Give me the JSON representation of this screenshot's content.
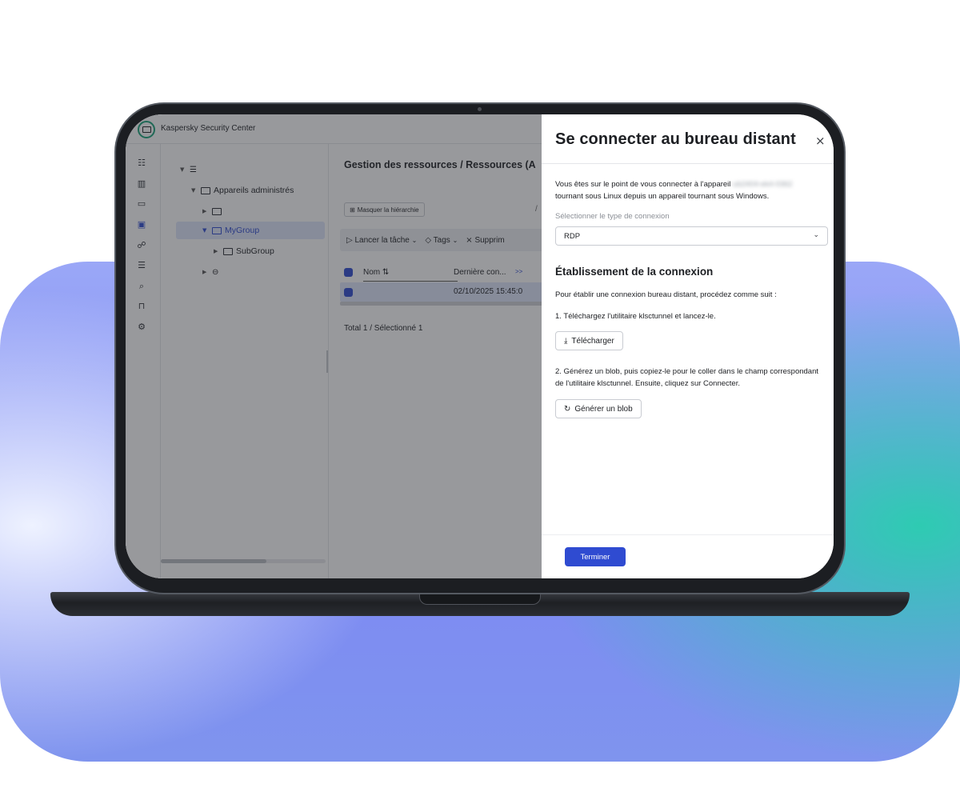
{
  "app": {
    "title": "Kaspersky Security Center",
    "rail_icons": [
      "dashboard-icon",
      "map-icon",
      "monitor-icon",
      "devices-icon",
      "users-icon",
      "servers-icon",
      "search-icon",
      "store-icon",
      "settings-icon"
    ],
    "rail_expand": ">>"
  },
  "tree": {
    "items": [
      {
        "label": ""
      },
      {
        "label": "Appareils administrés"
      },
      {
        "label": ""
      },
      {
        "label": "MyGroup"
      },
      {
        "label": "SubGroup"
      },
      {
        "label": ""
      }
    ]
  },
  "main": {
    "breadcrumb": "Gestion des ressources  /  Ressources (A",
    "hide_hierarchy": "Masquer la hiérarchie",
    "slash": "/",
    "toolbar": {
      "launch_task": "Lancer la tâche",
      "tags": "Tags",
      "delete": "Supprim"
    },
    "table": {
      "col_name": "Nom ⇅",
      "col_last_connection": "Dernière con...",
      "col_more": ">>",
      "row_date": "02/10/2025 15:45:0"
    },
    "total": "Total 1 / Sélectionné 1"
  },
  "dialog": {
    "title": "Se connecter au bureau distant",
    "close": "×",
    "intro_line1": "Vous êtes sur le point de vous connecter à l'appareil",
    "intro_hidden": "ub2404-ek4-0362",
    "intro_line2": "tournant sous Linux depuis un appareil tournant sous Windows.",
    "connection_type_label": "Sélectionner le type de connexion",
    "connection_type_value": "RDP",
    "section_title": "Établissement de la connexion",
    "steps_intro": "Pour établir une connexion bureau distant, procédez comme suit :",
    "step1": "1. Téléchargez l'utilitaire klsctunnel et lancez-le.",
    "download_button": "Télécharger",
    "step2": "2. Générez un blob, puis copiez-le pour le coller dans le champ correspondant de l'utilitaire klsctunnel. Ensuite, cliquez sur Connecter.",
    "generate_button": "Générer un blob",
    "finish_button": "Terminer"
  },
  "colors": {
    "accent": "#2f4bd1",
    "logo": "#1aa37a",
    "bg_teal": "#2ecbb2",
    "bg_violet": "#7d8af3"
  }
}
